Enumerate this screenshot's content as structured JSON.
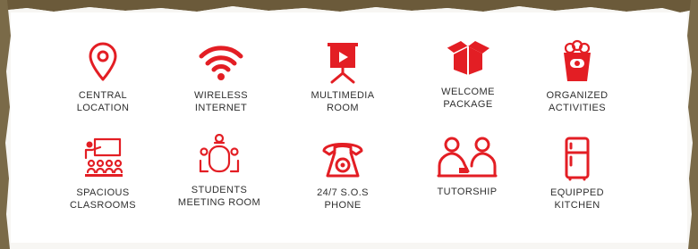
{
  "accent_color": "#e31e24",
  "features": [
    {
      "label": "CENTRAL\nLOCATION",
      "icon": "map-pin-icon"
    },
    {
      "label": "WIRELESS\nINTERNET",
      "icon": "wifi-icon"
    },
    {
      "label": "MULTIMEDIA\nROOM",
      "icon": "projector-screen-icon"
    },
    {
      "label": "WELCOME\nPACKAGE",
      "icon": "open-box-icon"
    },
    {
      "label": "ORGANIZED\nACTIVITIES",
      "icon": "popcorn-icon"
    },
    {
      "label": "SPACIOUS\nCLASROOMS",
      "icon": "classroom-icon"
    },
    {
      "label": "STUDENTS\nMEETING ROOM",
      "icon": "meeting-table-icon"
    },
    {
      "label": "24/7 S.O.S\nPHONE",
      "icon": "telephone-icon"
    },
    {
      "label": "TUTORSHIP",
      "icon": "tutor-icon"
    },
    {
      "label": "EQUIPPED\nKITCHEN",
      "icon": "fridge-icon"
    }
  ]
}
